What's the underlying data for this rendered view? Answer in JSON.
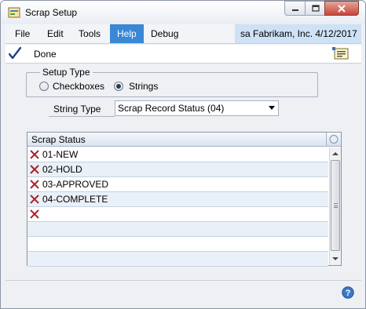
{
  "window": {
    "title": "Scrap Setup",
    "icon": "scrap-setup-app-icon"
  },
  "menu": {
    "items": [
      "File",
      "Edit",
      "Tools",
      "Help",
      "Debug"
    ],
    "active": "Help"
  },
  "user_info": "sa  Fabrikam, Inc.  4/12/2017",
  "toolbar": {
    "done_label": "Done",
    "done_icon": "checkmark-icon",
    "note_icon": "note-icon"
  },
  "setup_type": {
    "legend": "Setup Type",
    "options": [
      "Checkboxes",
      "Strings"
    ],
    "selected": "Strings"
  },
  "string_type": {
    "label": "String Type",
    "value": "Scrap Record Status (04)"
  },
  "grid": {
    "header": "Scrap Status",
    "rows": [
      "01-NEW",
      "02-HOLD",
      "03-APPROVED",
      "04-COMPLETE",
      ""
    ],
    "empty_rows": 3,
    "delete_icon": "delete-x-icon"
  },
  "colors": {
    "accent": "#3a87d6",
    "user_info_bg": "#cfe1f4",
    "delete_x": "#a8242d"
  }
}
